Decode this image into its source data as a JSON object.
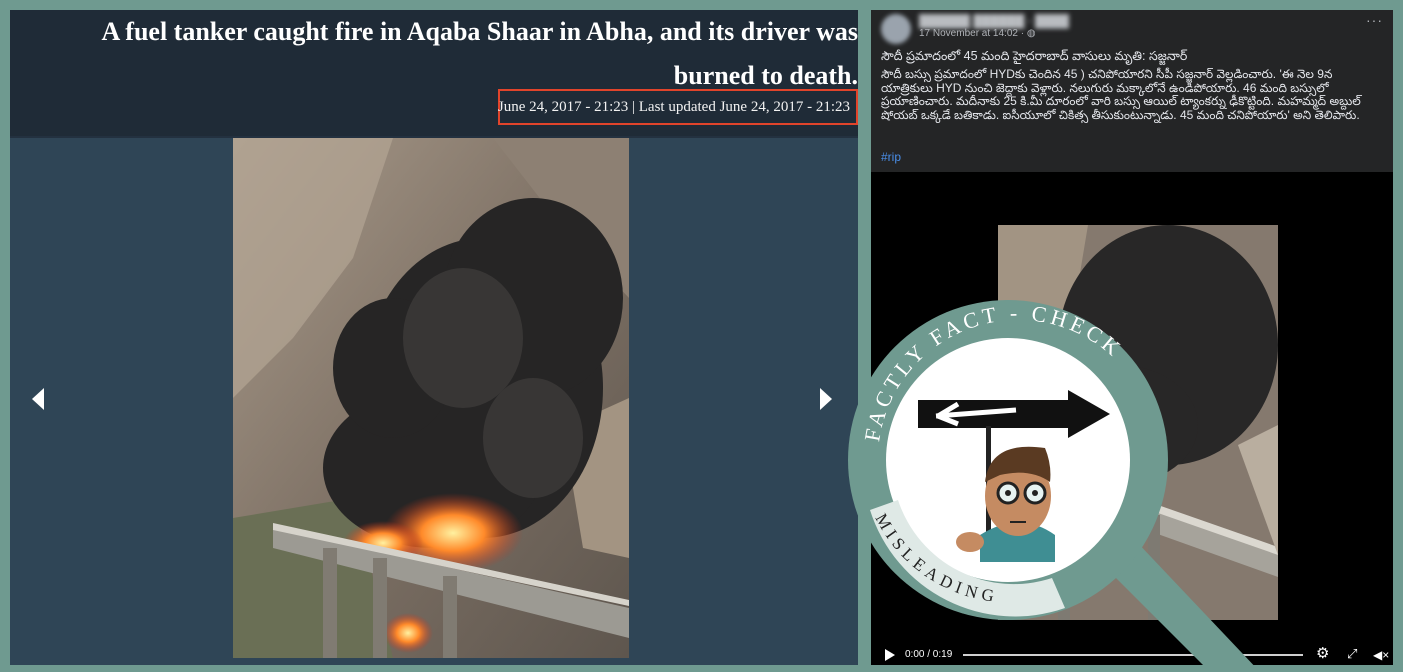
{
  "article": {
    "headline": "A fuel tanker caught fire in Aqaba Shaar in Abha, and its driver was burned to death.",
    "dateline": "June 24, 2017 - 21:23 | Last updated June 24, 2017 - 21:23"
  },
  "post": {
    "timestamp": "17 November at 14:02 ·",
    "more": "···",
    "title": "సౌదీ ప్రమాదంలో 45 మంది హైదరాబాద్ వాసులు మృతి: సజ్జనార్",
    "body": "సౌదీ బస్సు ప్రమాదంలో HYDకు చెందిన 45 ) చనిపోయారని సీపీ సజ్జనార్ వెల్లడించారు. 'ఈ నెల 9న యాత్రికులు HYD నుంచి జెద్దాకు వెళ్లారు. నలుగురు మక్కాలోనే ఉండిపోయారు. 46 మంది బస్సులో ప్రయాణించారు. మదీనాకు 25 కి.మీ దూరంలో వారి బస్సు ఆయిల్ ట్యాంకర్ను ఢీకొట్టింది. మహమ్మద్ అబ్దుల్ షోయబ్ ఒక్కడే బతికాడు. ఐసీయూలో చికిత్స తీసుకుంటున్నాడు. 45 మంది చనిపోయారు' అని తెలిపారు.",
    "hashtag": "#rip"
  },
  "video": {
    "time": "0:00 / 0:19"
  },
  "stamp": {
    "ring_text": "FACTLY FACT - CHECK",
    "verdict": "MISLEADING"
  },
  "colors": {
    "background": "#6f9a90",
    "highlight": "#e1442b",
    "stamp": "#6f9a90"
  }
}
